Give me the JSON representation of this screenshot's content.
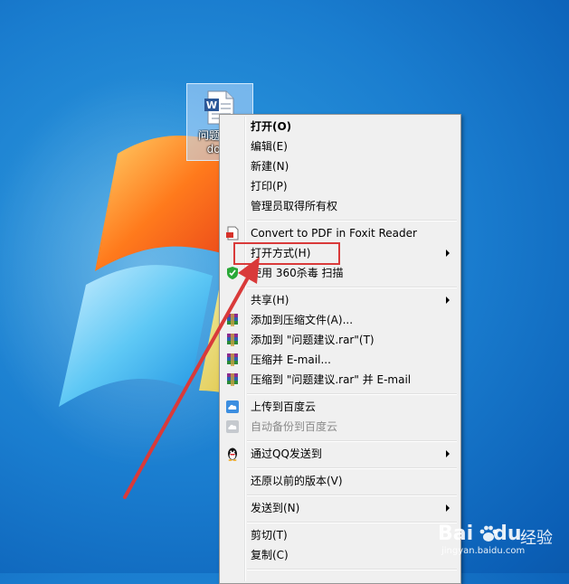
{
  "desktop": {
    "icon_label_line1": "问题建议",
    "icon_label_line2": "docx",
    "icon": "word-document-icon"
  },
  "context_menu": {
    "items": {
      "open": "打开(O)",
      "edit": "编辑(E)",
      "new": "新建(N)",
      "print": "打印(P)",
      "take_ownership": "管理员取得所有权",
      "foxit": "Convert to PDF in Foxit Reader",
      "open_with": "打开方式(H)",
      "scan_360": "使用 360杀毒 扫描",
      "share": "共享(H)",
      "add_archive": "添加到压缩文件(A)...",
      "add_to_rar": "添加到 \"问题建议.rar\"(T)",
      "compress_email": "压缩并 E-mail...",
      "compress_rar_email": "压缩到 \"问题建议.rar\" 并 E-mail",
      "upload_baidu": "上传到百度云",
      "auto_backup": "自动备份到百度云",
      "send_qq": "通过QQ发送到",
      "restore": "还原以前的版本(V)",
      "send_to": "发送到(N)",
      "cut": "剪切(T)",
      "copy": "复制(C)"
    }
  },
  "watermark": {
    "brand": "Bai",
    "brand2": "du",
    "cn": "经验",
    "url": "jingyan.baidu.com"
  },
  "colors": {
    "annotation_red": "#d93a3a",
    "desktop_blue": "#1a7dcf"
  }
}
